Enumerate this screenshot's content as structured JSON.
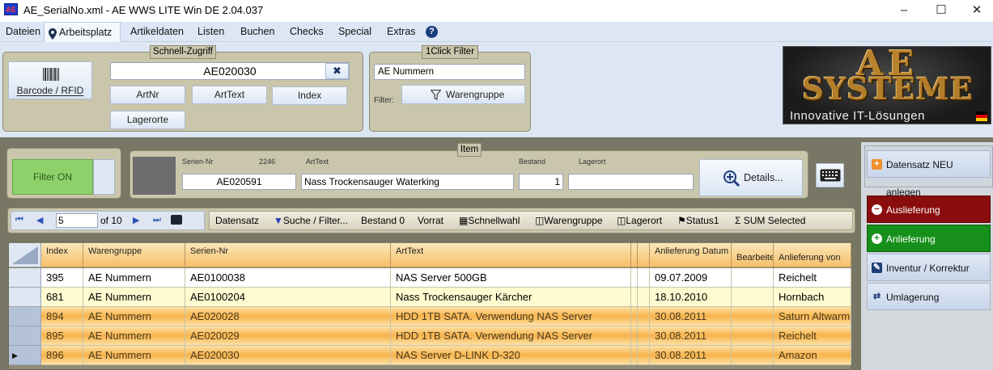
{
  "window": {
    "title": "AE_SerialNo.xml - AE WWS LITE Win DE 2.04.037",
    "app_icon": "AE",
    "min": "–",
    "max": "☐",
    "close": "✕"
  },
  "menu": [
    "Dateien",
    "Arbeitsplatz",
    "Artikeldaten",
    "Listen",
    "Buchen",
    "Checks",
    "Special",
    "Extras"
  ],
  "help_icon": "?",
  "schnell": {
    "title": "Schnell-Zugriff",
    "barcode_label": "Barcode / RFID",
    "search_value": "AE020030",
    "clear_icon": "✖",
    "btn_artnr": "ArtNr",
    "btn_arttext": "ArtText",
    "btn_index": "Index",
    "btn_lagerorte": "Lagerorte"
  },
  "oneclick": {
    "title": "1Click Filter",
    "value": "AE Nummern",
    "filter_label": "Filter:",
    "btn_warengruppe": "Warengruppe"
  },
  "logo": {
    "line1": "AE",
    "line2": "SYSTEME",
    "tagline": "Innovative IT-Lösungen"
  },
  "filter_toggle": "Filter ON",
  "item": {
    "title": "Item",
    "lbl_serien": "Serien-Nr",
    "lbl_count": "2246",
    "lbl_arttext": "ArtText",
    "lbl_bestand": "Bestand",
    "lbl_lagerort": "Lagerort",
    "serien": "AE020591",
    "arttext": "Nass Trockensauger Waterking",
    "bestand": "1",
    "lagerort": "",
    "details": "Details..."
  },
  "nav": {
    "page": "5",
    "of": "of 10"
  },
  "toolbar": {
    "datensatz": "Datensatz",
    "suche": "Suche / Filter...",
    "bestand": "Bestand 0",
    "vorrat": "Vorrat",
    "schnellwahl": "Schnellwahl",
    "warengruppe": "Warengruppe",
    "lagerort": "Lagerort",
    "status": "Status1",
    "sum": "SUM Selected"
  },
  "right": {
    "neu": "Datensatz NEU anlegen",
    "aus": "Auslieferung",
    "an": "Anlieferung",
    "inv": "Inventur / Korrektur",
    "um": "Umlagerung"
  },
  "columns": [
    "Index",
    "Warengruppe",
    "Serien-Nr",
    "ArtText",
    "",
    "",
    "Anlieferung Datum",
    "Bearbeiter",
    "Anlieferung von"
  ],
  "rows": [
    {
      "index": "395",
      "wg": "AE Nummern",
      "serien": "AE0100038",
      "arttext": "NAS Server 500GB",
      "datum": "09.07.2009",
      "bearb": "",
      "von": "Reichelt",
      "style": "white",
      "marker": ""
    },
    {
      "index": "681",
      "wg": "AE Nummern",
      "serien": "AE0100204",
      "arttext": "Nass Trockensauger Kärcher",
      "datum": "18.10.2010",
      "bearb": "",
      "von": "Hornbach",
      "style": "yellow",
      "marker": ""
    },
    {
      "index": "894",
      "wg": "AE Nummern",
      "serien": "AE020028",
      "arttext": "HDD 1TB SATA. Verwendung NAS Server",
      "datum": "30.08.2011",
      "bearb": "",
      "von": "Saturn Altwarmbüchen",
      "style": "orange",
      "marker": ""
    },
    {
      "index": "895",
      "wg": "AE Nummern",
      "serien": "AE020029",
      "arttext": "HDD 1TB SATA. Verwendung NAS Server",
      "datum": "30.08.2011",
      "bearb": "",
      "von": "Reichelt",
      "style": "orange",
      "marker": ""
    },
    {
      "index": "896",
      "wg": "AE Nummern",
      "serien": "AE020030",
      "arttext": "NAS Server D-LINK D-320",
      "datum": "30.08.2011",
      "bearb": "",
      "von": "Amazon",
      "style": "orange",
      "marker": "▶"
    }
  ]
}
